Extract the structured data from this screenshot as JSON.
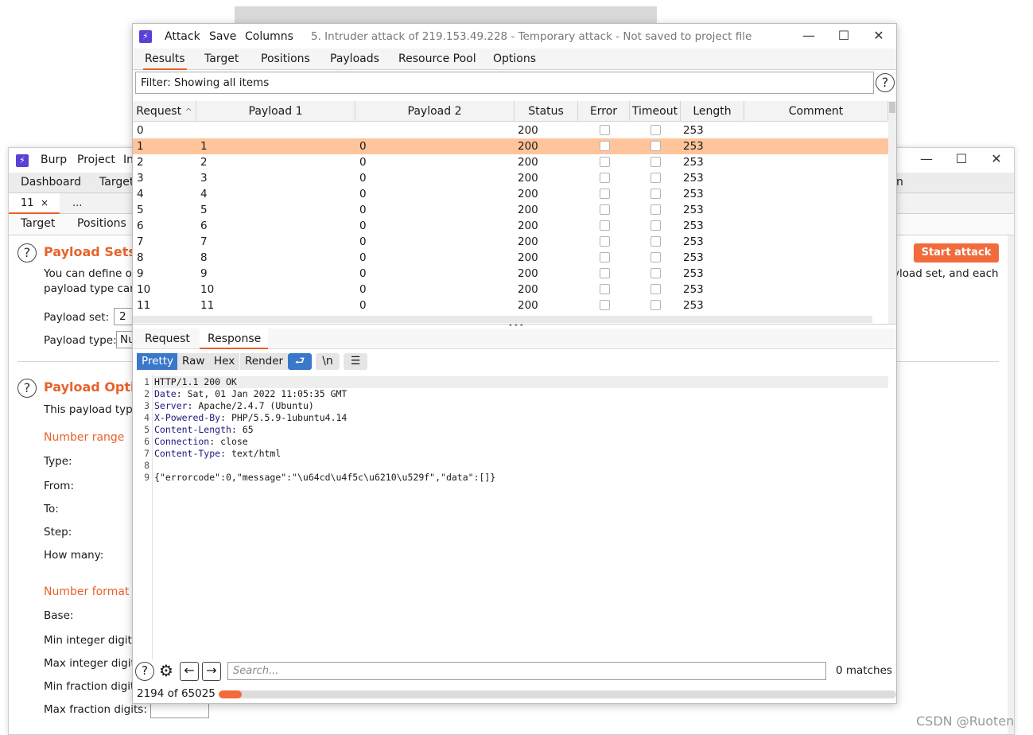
{
  "background_window": {
    "menu": [
      "Burp",
      "Project",
      "In"
    ],
    "tabs": [
      "Dashboard",
      "Target"
    ],
    "tab_right_fragment": "n",
    "subtabs": [
      {
        "label": "11",
        "close": "×"
      },
      {
        "label": "..."
      }
    ],
    "subtabs2": [
      "Target",
      "Positions"
    ],
    "start_attack": "Start attack",
    "payload_sets": {
      "title": "Payload Sets",
      "desc_line1": "You can define on",
      "desc_line2": "payload type can b",
      "desc_right": "yload set, and each",
      "set_label": "Payload set:",
      "set_value": "2",
      "type_label": "Payload type:",
      "type_value": "Nu"
    },
    "payload_options": {
      "title": "Payload Option",
      "desc": "This payload type",
      "number_range": "Number range",
      "range_fields": [
        "Type:",
        "From:",
        "To:",
        "Step:",
        "How many:"
      ],
      "number_format": "Number format",
      "format_fields": [
        "Base:",
        "Min integer digits:",
        "Max integer digits",
        "Min fraction digits",
        "Max fraction digits:"
      ]
    }
  },
  "attack_window": {
    "menu": [
      "Attack",
      "Save",
      "Columns"
    ],
    "title": "5. Intruder attack of 219.153.49.228 - Temporary attack - Not saved to project file",
    "tabs": [
      "Results",
      "Target",
      "Positions",
      "Payloads",
      "Resource Pool",
      "Options"
    ],
    "active_tab": "Results",
    "filter": "Filter: Showing all items",
    "columns": [
      "Request",
      "Payload 1",
      "Payload 2",
      "Status",
      "Error",
      "Timeout",
      "Length",
      "Comment"
    ],
    "sort_arrow": "^",
    "rows": [
      {
        "request": "0",
        "p1": "",
        "p2": "",
        "status": "200",
        "length": "253",
        "selected": false
      },
      {
        "request": "1",
        "p1": "1",
        "p2": "0",
        "status": "200",
        "length": "253",
        "selected": true
      },
      {
        "request": "2",
        "p1": "2",
        "p2": "0",
        "status": "200",
        "length": "253",
        "selected": false
      },
      {
        "request": "3",
        "p1": "3",
        "p2": "0",
        "status": "200",
        "length": "253",
        "selected": false
      },
      {
        "request": "4",
        "p1": "4",
        "p2": "0",
        "status": "200",
        "length": "253",
        "selected": false
      },
      {
        "request": "5",
        "p1": "5",
        "p2": "0",
        "status": "200",
        "length": "253",
        "selected": false
      },
      {
        "request": "6",
        "p1": "6",
        "p2": "0",
        "status": "200",
        "length": "253",
        "selected": false
      },
      {
        "request": "7",
        "p1": "7",
        "p2": "0",
        "status": "200",
        "length": "253",
        "selected": false
      },
      {
        "request": "8",
        "p1": "8",
        "p2": "0",
        "status": "200",
        "length": "253",
        "selected": false
      },
      {
        "request": "9",
        "p1": "9",
        "p2": "0",
        "status": "200",
        "length": "253",
        "selected": false
      },
      {
        "request": "10",
        "p1": "10",
        "p2": "0",
        "status": "200",
        "length": "253",
        "selected": false
      },
      {
        "request": "11",
        "p1": "11",
        "p2": "0",
        "status": "200",
        "length": "253",
        "selected": false
      }
    ],
    "rr_tabs": [
      "Request",
      "Response"
    ],
    "rr_active": "Response",
    "view_buttons": [
      "Pretty",
      "Raw",
      "Hex",
      "Render"
    ],
    "view_active": "Pretty",
    "newline_btn": "\\n",
    "response_lines": [
      {
        "n": "1",
        "key": "",
        "val": "HTTP/1.1 200 OK"
      },
      {
        "n": "2",
        "key": "Date",
        "val": " Sat, 01 Jan 2022 11:05:35 GMT"
      },
      {
        "n": "3",
        "key": "Server",
        "val": " Apache/2.4.7 (Ubuntu)"
      },
      {
        "n": "4",
        "key": "X-Powered-By",
        "val": " PHP/5.5.9-1ubuntu4.14"
      },
      {
        "n": "5",
        "key": "Content-Length",
        "val": " 65"
      },
      {
        "n": "6",
        "key": "Connection",
        "val": " close"
      },
      {
        "n": "7",
        "key": "Content-Type",
        "val": " text/html"
      },
      {
        "n": "8",
        "key": "",
        "val": ""
      },
      {
        "n": "9",
        "key": "",
        "val": "{\"errorcode\":0,\"message\":\"\\u64cd\\u4f5c\\u6210\\u529f\",\"data\":[]}"
      }
    ],
    "search_placeholder": "Search...",
    "matches": "0 matches",
    "progress_text": "2194 of 65025",
    "progress_fraction": 0.0337
  },
  "watermark": "CSDN @Ruoten",
  "colors": {
    "accent": "#e8622c",
    "selected_row": "#ffc49a",
    "active_view": "#3a78c9"
  }
}
